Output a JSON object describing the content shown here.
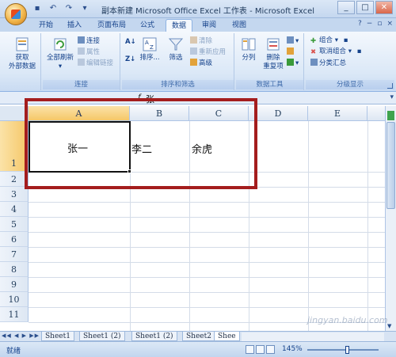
{
  "window": {
    "title": "副本新建 Microsoft Office Excel 工作表 - Microsoft Excel",
    "controls": [
      "_",
      "□",
      "✕"
    ]
  },
  "quick_access": [
    "save-icon",
    "undo-icon",
    "redo-icon",
    "customize-icon"
  ],
  "tabs": [
    {
      "label": "开始"
    },
    {
      "label": "插入"
    },
    {
      "label": "页面布局"
    },
    {
      "label": "公式"
    },
    {
      "label": "数据",
      "active": true
    },
    {
      "label": "审阅"
    },
    {
      "label": "视图"
    }
  ],
  "ribbon": {
    "get_external": {
      "label": "获取\n外部数据",
      "line1": "获取",
      "line2": "外部数据"
    },
    "connections": {
      "group_label": "连接",
      "refresh_all": "全部刷新",
      "connections": "连接",
      "properties": "属性",
      "edit_links": "编辑链接"
    },
    "sort_filter": {
      "group_label": "排序和筛选",
      "sort": "排序...",
      "filter": "筛选",
      "clear": "清除",
      "reapply": "重新应用",
      "advanced": "高级"
    },
    "data_tools": {
      "group_label": "数据工具",
      "text_to_columns": "分列",
      "remove_dup_1": "删除",
      "remove_dup_2": "重复项"
    },
    "outline": {
      "group_label": "分级显示",
      "group": "组合",
      "ungroup": "取消组合",
      "subtotal": "分类汇总"
    }
  },
  "formula_bar": {
    "fx": "f",
    "value": "张"
  },
  "columns": [
    "A",
    "B",
    "C",
    "D",
    "E"
  ],
  "rows": [
    "1",
    "2",
    "3",
    "4",
    "5",
    "6",
    "7",
    "8",
    "9",
    "10",
    "11"
  ],
  "cells": {
    "A1": "张一",
    "B1": "李二",
    "C1": "余虎"
  },
  "sheet_tabs": [
    "Sheet1",
    "Sheet1 (2)",
    "Sheet1 (2)",
    "Sheet2",
    "Shee"
  ],
  "sheet_nav": "◀◀ ◀ ▶ ▶▶",
  "status": {
    "ready": "就绪",
    "zoom": "145%"
  },
  "watermark": "jingyan.baidu.com",
  "colors": {
    "selection_highlight": "#f5c768",
    "red_annotation": "#a41d1d",
    "ribbon_blue": "#c4d7ef"
  }
}
